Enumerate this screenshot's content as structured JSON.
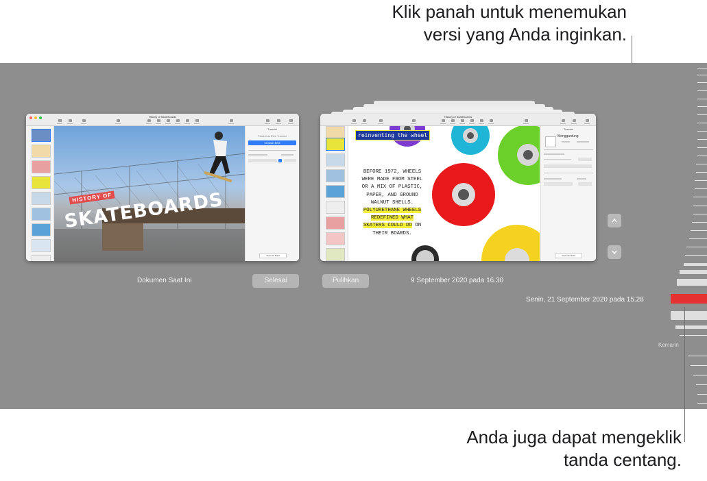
{
  "callouts": {
    "top_line1": "Klik panah untuk menemukan",
    "top_line2": "versi yang Anda inginkan.",
    "bottom_line1": "Anda juga dapat mengeklik",
    "bottom_line2": "tanda centang."
  },
  "current_window": {
    "title": "History of Skateboards",
    "slide_title_small": "HISTORY OF",
    "slide_title_big": "SKATEBOARDS",
    "inspector_heading": "Transisi",
    "inspector_button": "Tambah Efek",
    "inspector_status": "Tidak Ada Efek Transisi",
    "bottom_button": "Susunan Build"
  },
  "previous_window": {
    "title": "History of Skateboards",
    "slide_heading": "reinventing the wheel",
    "body_lines": [
      "BEFORE 1972, WHEELS",
      "WERE MADE FROM STEEL",
      "OR A MIX OF PLASTIC,",
      "PAPER, AND GROUND",
      "WALNUT SHELLS."
    ],
    "highlight_lines": [
      "POLYURETHANE WHEELS",
      "REDEFINED WHAT",
      "SKATERS COULD DO"
    ],
    "highlight_tail": " ON",
    "closing_line": "THEIR BOARDS.",
    "inspector_heading": "Transisi",
    "inspector_label": "Menggantung",
    "bottom_button": "Susunan Build"
  },
  "labels": {
    "current_document": "Dokumen Saat Ini",
    "done_button": "Selesai",
    "restore_button": "Pulihkan",
    "version_date": "9 September 2020 pada 16.30",
    "timeline_selected": "Senin, 21 September 2020 pada 15.28",
    "timeline_yesterday": "Kemarin"
  },
  "colors": {
    "backdrop": "#8e8e8e",
    "timeline_selected": "#e5322e",
    "highlight": "#f5ef3a",
    "inspector_button": "#2f7cf6"
  },
  "icons": {
    "up": "chevron-up-icon",
    "down": "chevron-down-icon"
  }
}
